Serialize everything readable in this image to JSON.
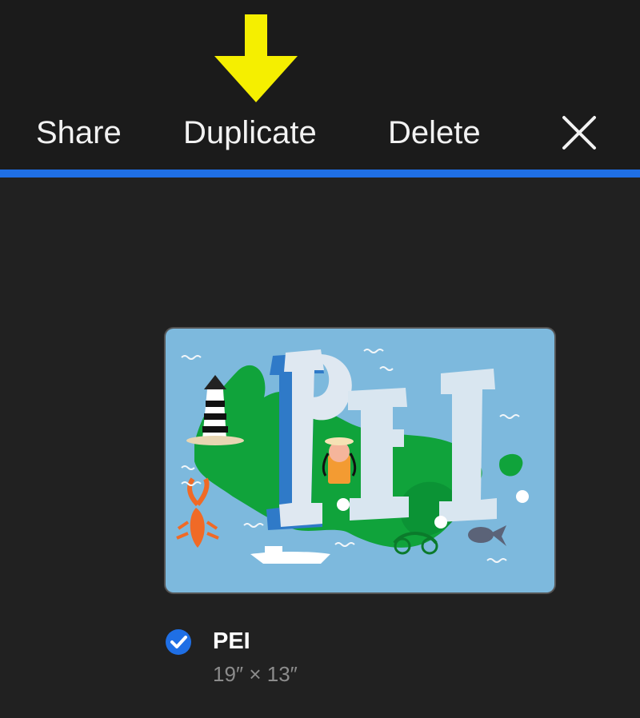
{
  "toolbar": {
    "share_label": "Share",
    "duplicate_label": "Duplicate",
    "delete_label": "Delete",
    "close_icon": "close-icon",
    "annotation_arrow": "arrow-down-icon",
    "accent_color": "#1f6fe5",
    "arrow_color": "#f5ef00"
  },
  "artwork": {
    "title": "PEI",
    "dimensions": "19″ × 13″",
    "selected": true,
    "thumbnail_text": "PEI",
    "thumbnail_icon": "artwork-thumbnail"
  }
}
